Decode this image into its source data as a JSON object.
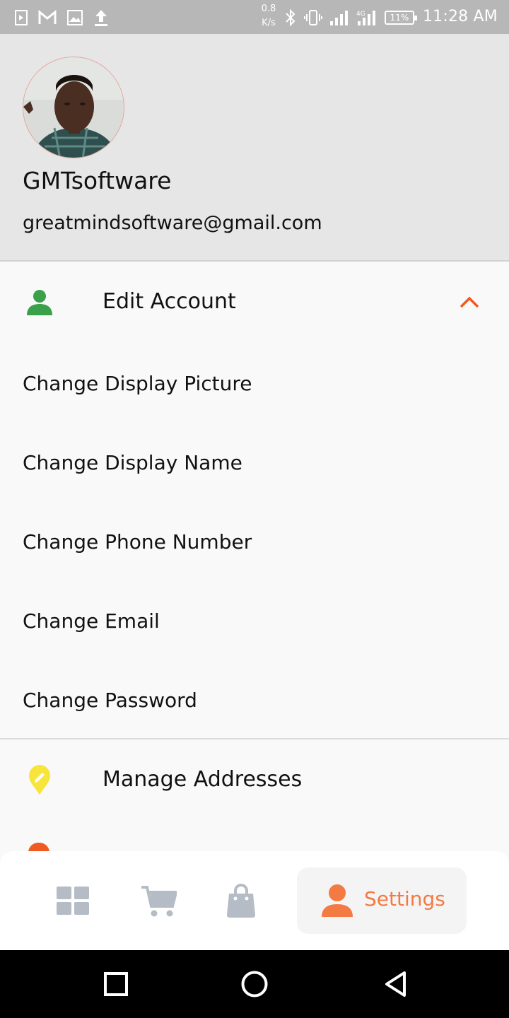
{
  "status_bar": {
    "speed_value": "0.8",
    "speed_unit": "K/s",
    "battery": "11%",
    "time": "11:28 AM",
    "icons": [
      "video-icon",
      "gmail-icon",
      "image-icon",
      "upload-icon",
      "bluetooth-icon",
      "vibrate-icon",
      "signal-icon",
      "4g-signal-icon",
      "battery-icon"
    ]
  },
  "profile": {
    "name": "GMTsoftware",
    "email": "greatmindsoftware@gmail.com"
  },
  "edit_account": {
    "label": "Edit Account",
    "icon": "person-icon",
    "icon_color": "#3aa14a",
    "expanded": true,
    "items": [
      "Change Display Picture",
      "Change Display Name",
      "Change Phone Number",
      "Change Email",
      "Change Password"
    ]
  },
  "manage_addresses": {
    "label": "Manage Addresses",
    "icon": "location-pin-icon",
    "icon_color": "#f7e53b"
  },
  "bottom_nav": {
    "items": [
      {
        "icon": "dashboard-icon",
        "active": false
      },
      {
        "icon": "cart-icon",
        "active": false
      },
      {
        "icon": "shopping-bag-icon",
        "active": false
      },
      {
        "icon": "person-icon",
        "label": "Settings",
        "active": true
      }
    ],
    "active_color": "#f47a43",
    "inactive_color": "#b5bcc6"
  },
  "colors": {
    "accent": "#f05a22",
    "header_bg": "#e6e6e6"
  }
}
